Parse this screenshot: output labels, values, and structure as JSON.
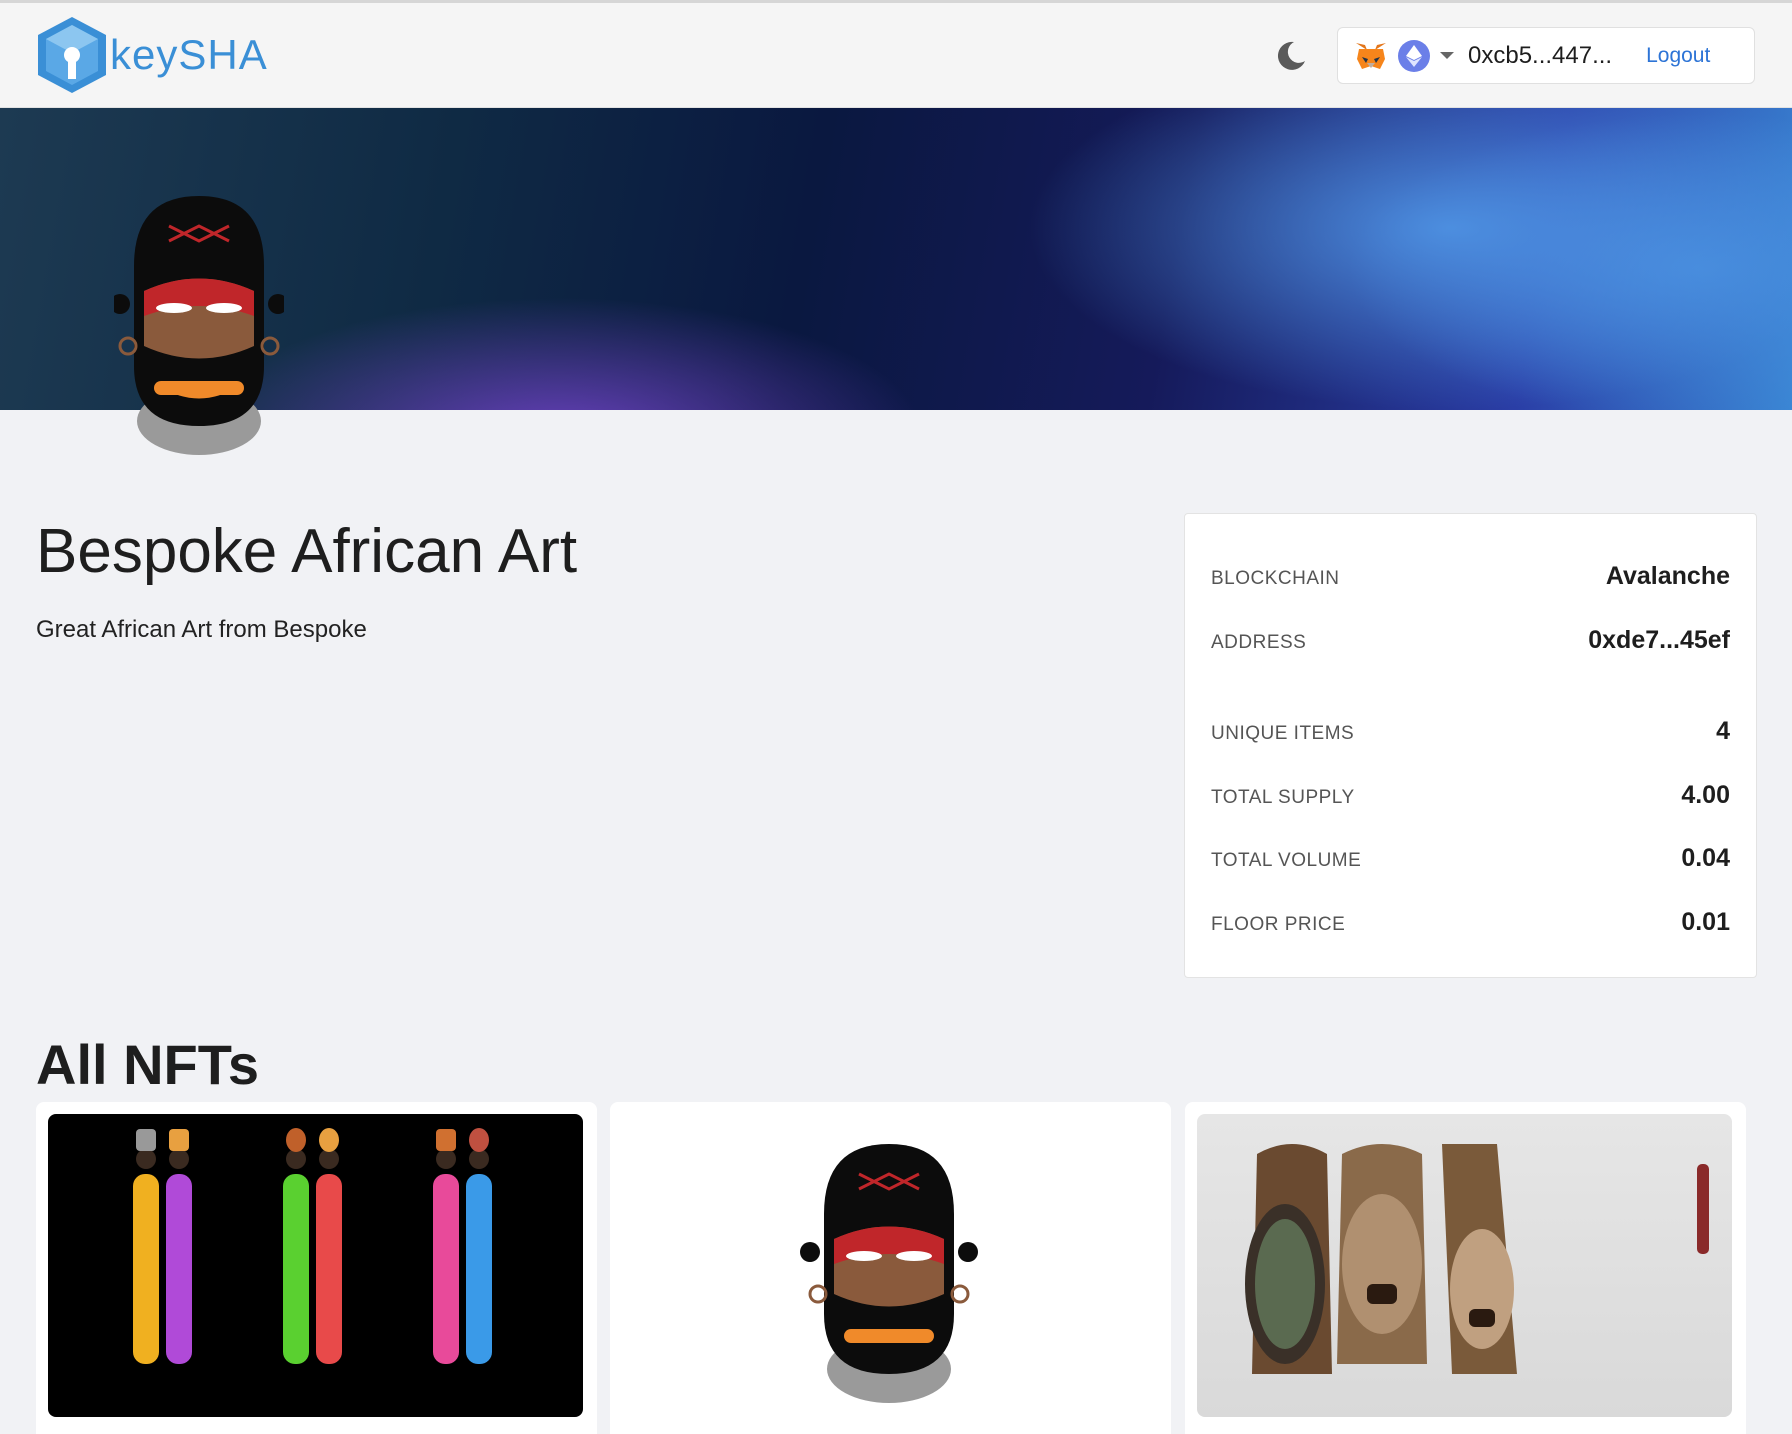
{
  "header": {
    "brand": "keySHA",
    "theme_toggle_icon": "moon-icon",
    "wallet": {
      "provider_icon": "metamask-fox-icon",
      "network_icon": "ethereum-icon",
      "address": "0xcb5...447...",
      "logout_label": "Logout"
    }
  },
  "collection": {
    "name": "Bespoke African Art",
    "description": "Great African Art from Bespoke",
    "stats": [
      {
        "label": "BLOCKCHAIN",
        "value": "Avalanche"
      },
      {
        "label": "ADDRESS",
        "value": "0xde7...45ef"
      },
      {
        "label": "UNIQUE ITEMS",
        "value": "4"
      },
      {
        "label": "TOTAL SUPPLY",
        "value": "4.00"
      },
      {
        "label": "TOTAL VOLUME",
        "value": "0.04"
      },
      {
        "label": "FLOOR PRICE",
        "value": "0.01"
      }
    ]
  },
  "nfts": {
    "section_title": "All NFTs"
  },
  "colors": {
    "accent": "#2d74d6",
    "brand": "#3a8fd6",
    "page_bg": "#f1f2f5"
  }
}
